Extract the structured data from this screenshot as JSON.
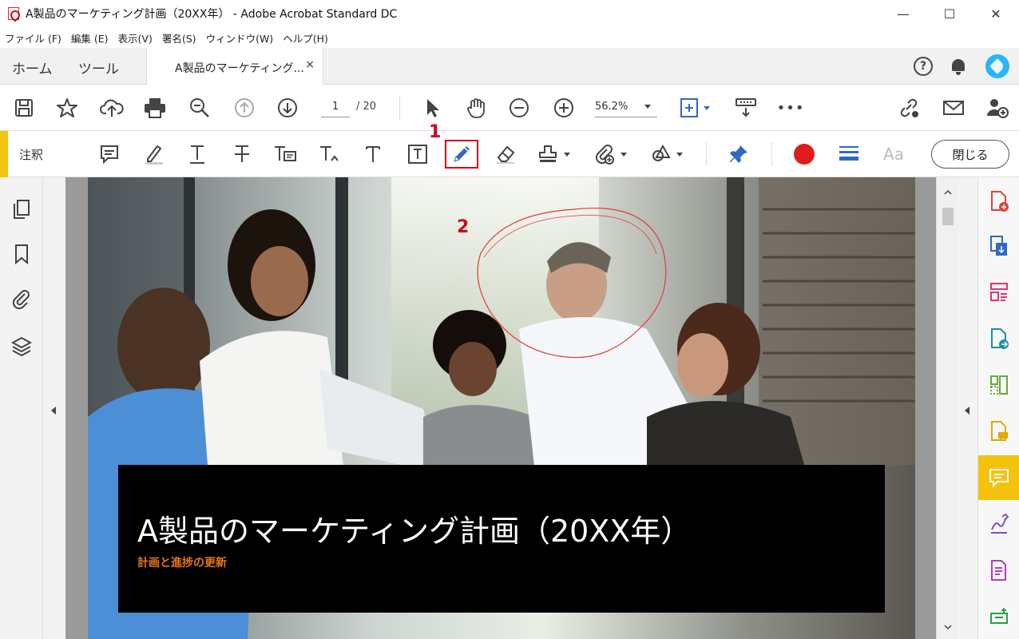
{
  "window": {
    "title": "A製品のマーケティング計画（20XX年） - Adobe Acrobat Standard DC",
    "minimize": "—",
    "maximize": "☐",
    "close": "✕"
  },
  "menu": [
    "ファイル (F)",
    "編集 (E)",
    "表示(V)",
    "署名(S)",
    "ウィンドウ(W)",
    "ヘルプ(H)"
  ],
  "tabs": {
    "home": "ホーム",
    "tools": "ツール",
    "document": "A製品のマーケティング...",
    "document_close": "×"
  },
  "toolbar": {
    "current_page": "1",
    "total_pages": "/ 20",
    "zoom": "56.2%",
    "more": "•••"
  },
  "comment_toolbar": {
    "label": "注釈",
    "close_label": "閉じる",
    "text_props_label": "Aa",
    "drawing_color": "#e01b1b",
    "selected_tool": "draw-freeform-pencil-icon"
  },
  "annotations": {
    "step1": "1",
    "step2": "2",
    "freehand_stroke_color": "#e53935"
  },
  "document": {
    "banner_title": "A製品のマーケティング計画（20XX年）",
    "banner_subtitle": "計画と進捗の更新"
  },
  "right_panel": {
    "active_tool": "comment-tool-icon"
  }
}
